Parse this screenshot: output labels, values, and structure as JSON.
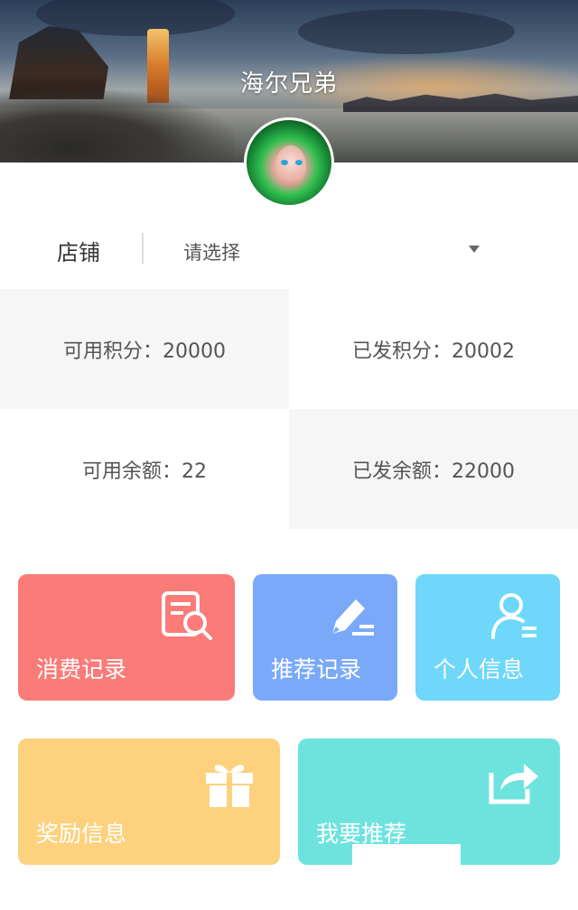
{
  "header": {
    "title": "海尔兄弟"
  },
  "shop": {
    "label": "店铺",
    "select_value": "请选择"
  },
  "stats": {
    "available_points": "可用积分：20000",
    "issued_points": "已发积分：20002",
    "available_balance": "可用余额：22",
    "issued_balance": "已发余额：22000"
  },
  "tiles": {
    "consume_records": {
      "label": "消费记录",
      "icon": "document-search-icon",
      "color": "#fb7b79"
    },
    "recommend_records": {
      "label": "推荐记录",
      "icon": "pen-edit-icon",
      "color": "#7aa9f9"
    },
    "personal_info": {
      "label": "个人信息",
      "icon": "user-list-icon",
      "color": "#6ed7fa"
    },
    "reward_info": {
      "label": "奖励信息",
      "icon": "gift-icon",
      "color": "#fdd17d"
    },
    "share": {
      "label": "我要推荐",
      "icon": "share-icon",
      "color": "#6ee3de"
    }
  }
}
